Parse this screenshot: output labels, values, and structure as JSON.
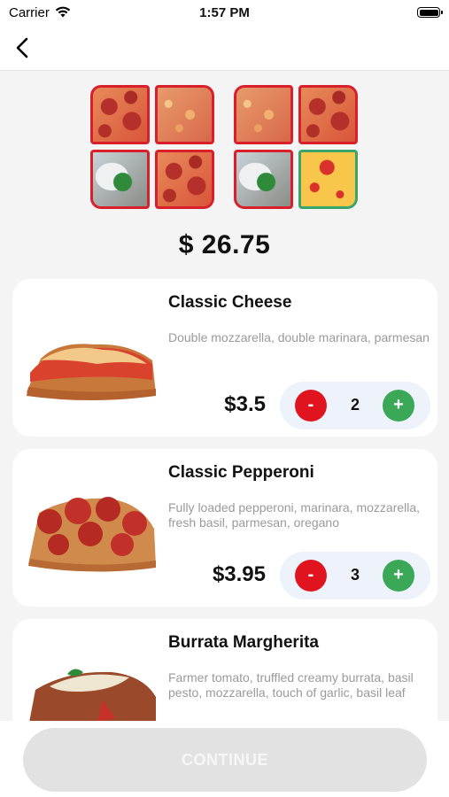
{
  "status_bar": {
    "carrier": "Carrier",
    "time": "1:57 PM"
  },
  "nav": {
    "back_icon": "chevron-left-icon"
  },
  "tray_slots": [
    {
      "tray": "left",
      "items": [
        "Classic Pepperoni",
        "Classic Cheese",
        "Burrata Margherita",
        "Classic Pepperoni"
      ]
    },
    {
      "tray": "right",
      "items": [
        "Classic Cheese",
        "Classic Pepperoni",
        "Burrata Margherita",
        "empty"
      ]
    }
  ],
  "total_price": "$ 26.75",
  "products": [
    {
      "name": "Classic Cheese",
      "description": "Double mozzarella, double marinara, parmesan",
      "price": "$3.5",
      "quantity": "2",
      "minus_label": "-",
      "plus_label": "+"
    },
    {
      "name": "Classic Pepperoni",
      "description": "Fully loaded pepperoni, marinara, mozzarella, fresh basil, parmesan, oregano",
      "price": "$3.95",
      "quantity": "3",
      "minus_label": "-",
      "plus_label": "+"
    },
    {
      "name": "Burrata Margherita",
      "description": "Farmer tomato, truffled creamy burrata, basil pesto, mozzarella, touch of garlic, basil leaf"
    }
  ],
  "continue_label": "CONTINUE",
  "colors": {
    "minus": "#e0141e",
    "plus": "#3aa856",
    "tray_border": "#d8202c",
    "empty_slot_border": "#3aa56a"
  }
}
